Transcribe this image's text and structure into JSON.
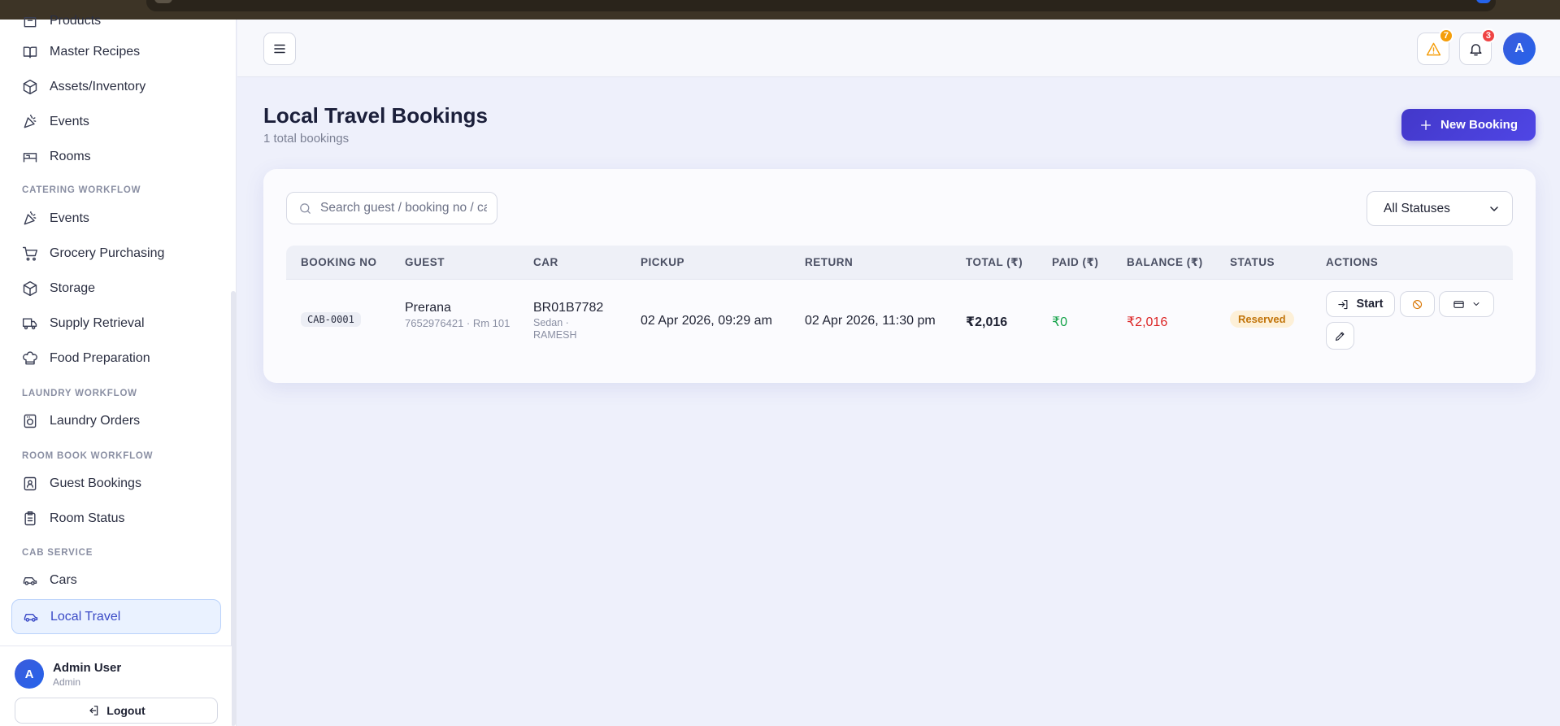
{
  "sidebar": {
    "items_top": [
      {
        "label": "Products",
        "icon": "box-icon"
      },
      {
        "label": "Master Recipes",
        "icon": "book-icon"
      },
      {
        "label": "Assets/Inventory",
        "icon": "cube-icon"
      },
      {
        "label": "Events",
        "icon": "party-icon"
      },
      {
        "label": "Rooms",
        "icon": "bed-icon"
      }
    ],
    "sections": {
      "catering": "CATERING WORKFLOW",
      "laundry": "LAUNDRY WORKFLOW",
      "roombook": "ROOM BOOK WORKFLOW",
      "cab": "CAB SERVICE"
    },
    "catering_items": [
      {
        "label": "Events",
        "icon": "party-icon"
      },
      {
        "label": "Grocery Purchasing",
        "icon": "cart-icon"
      },
      {
        "label": "Storage",
        "icon": "cube-icon"
      },
      {
        "label": "Supply Retrieval",
        "icon": "truck-icon"
      },
      {
        "label": "Food Preparation",
        "icon": "chef-hat-icon"
      }
    ],
    "laundry_items": [
      {
        "label": "Laundry Orders",
        "icon": "washer-icon"
      }
    ],
    "roombook_items": [
      {
        "label": "Guest Bookings",
        "icon": "contact-icon"
      },
      {
        "label": "Room Status",
        "icon": "clipboard-icon"
      }
    ],
    "cab_items": [
      {
        "label": "Cars",
        "icon": "car-icon"
      },
      {
        "label": "Local Travel",
        "icon": "car-icon",
        "active": true
      }
    ],
    "user": {
      "initial": "A",
      "name": "Admin User",
      "role": "Admin"
    },
    "logout_label": "Logout"
  },
  "header": {
    "alerts_count": "7",
    "notifications_count": "3",
    "avatar_initial": "A"
  },
  "page": {
    "title": "Local Travel Bookings",
    "subtitle": "1 total bookings",
    "new_booking_label": "New Booking"
  },
  "filters": {
    "search_placeholder": "Search guest / booking no / car",
    "status_selected": "All Statuses"
  },
  "table": {
    "columns": [
      "BOOKING NO",
      "GUEST",
      "CAR",
      "PICKUP",
      "RETURN",
      "TOTAL (₹)",
      "PAID (₹)",
      "BALANCE (₹)",
      "STATUS",
      "ACTIONS"
    ],
    "rows": [
      {
        "booking_no": "CAB-0001",
        "guest_name": "Prerana",
        "guest_meta": "7652976421 · Rm 101",
        "car_no": "BR01B7782",
        "car_meta": "Sedan · RAMESH",
        "pickup": "02 Apr 2026, 09:29 am",
        "return": "02 Apr 2026, 11:30 pm",
        "total": "₹2,016",
        "paid": "₹0",
        "balance": "₹2,016",
        "status": "Reserved",
        "start_label": "Start"
      }
    ]
  },
  "colors": {
    "accent": "#4338ca",
    "paid": "#16a34a",
    "balance": "#dc2626",
    "status_reserved": "#c2750b",
    "alert_badge": "#f59e0b",
    "notif_badge": "#ef4444"
  }
}
